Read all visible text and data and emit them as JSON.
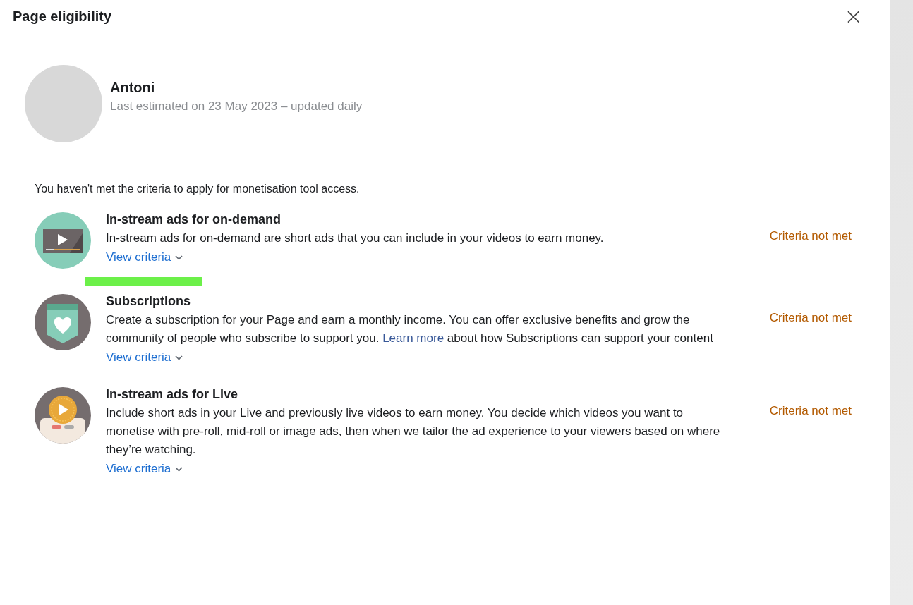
{
  "dialog": {
    "title": "Page eligibility",
    "close_label": "×"
  },
  "page": {
    "name": "Antoni",
    "subtitle": "Last estimated on 23 May 2023 – updated daily"
  },
  "intro": "You haven't met the criteria to apply for monetisation tool access.",
  "tools": [
    {
      "kind": "video",
      "title": "In-stream ads for on-demand",
      "description": [
        {
          "kind": "text",
          "text": "In-stream ads for on-demand are short ads that you can include in your videos to earn money."
        }
      ],
      "link": "View criteria",
      "status": "Criteria not met",
      "highlighted": true
    },
    {
      "kind": "subscription",
      "title": "Subscriptions",
      "description": [
        {
          "kind": "text",
          "text": "Create a subscription for your Page and earn a monthly income. You can offer exclusive benefits and grow the community of people who subscribe to support you. "
        },
        {
          "kind": "link",
          "text": "Learn more"
        },
        {
          "kind": "text",
          "text": " about how Subscriptions can support your content"
        }
      ],
      "link": "View criteria",
      "status": "Criteria not met",
      "highlighted": false
    },
    {
      "kind": "live",
      "title": "In-stream ads for Live",
      "description": [
        {
          "kind": "text",
          "text": "Include short ads in your Live and previously live videos to earn money. You decide which videos you want to monetise with pre-roll, mid-roll or image ads, then when we tailor the ad experience to your viewers based on where they’re watching."
        }
      ],
      "link": "View criteria",
      "status": "Criteria not met",
      "highlighted": false
    }
  ]
}
